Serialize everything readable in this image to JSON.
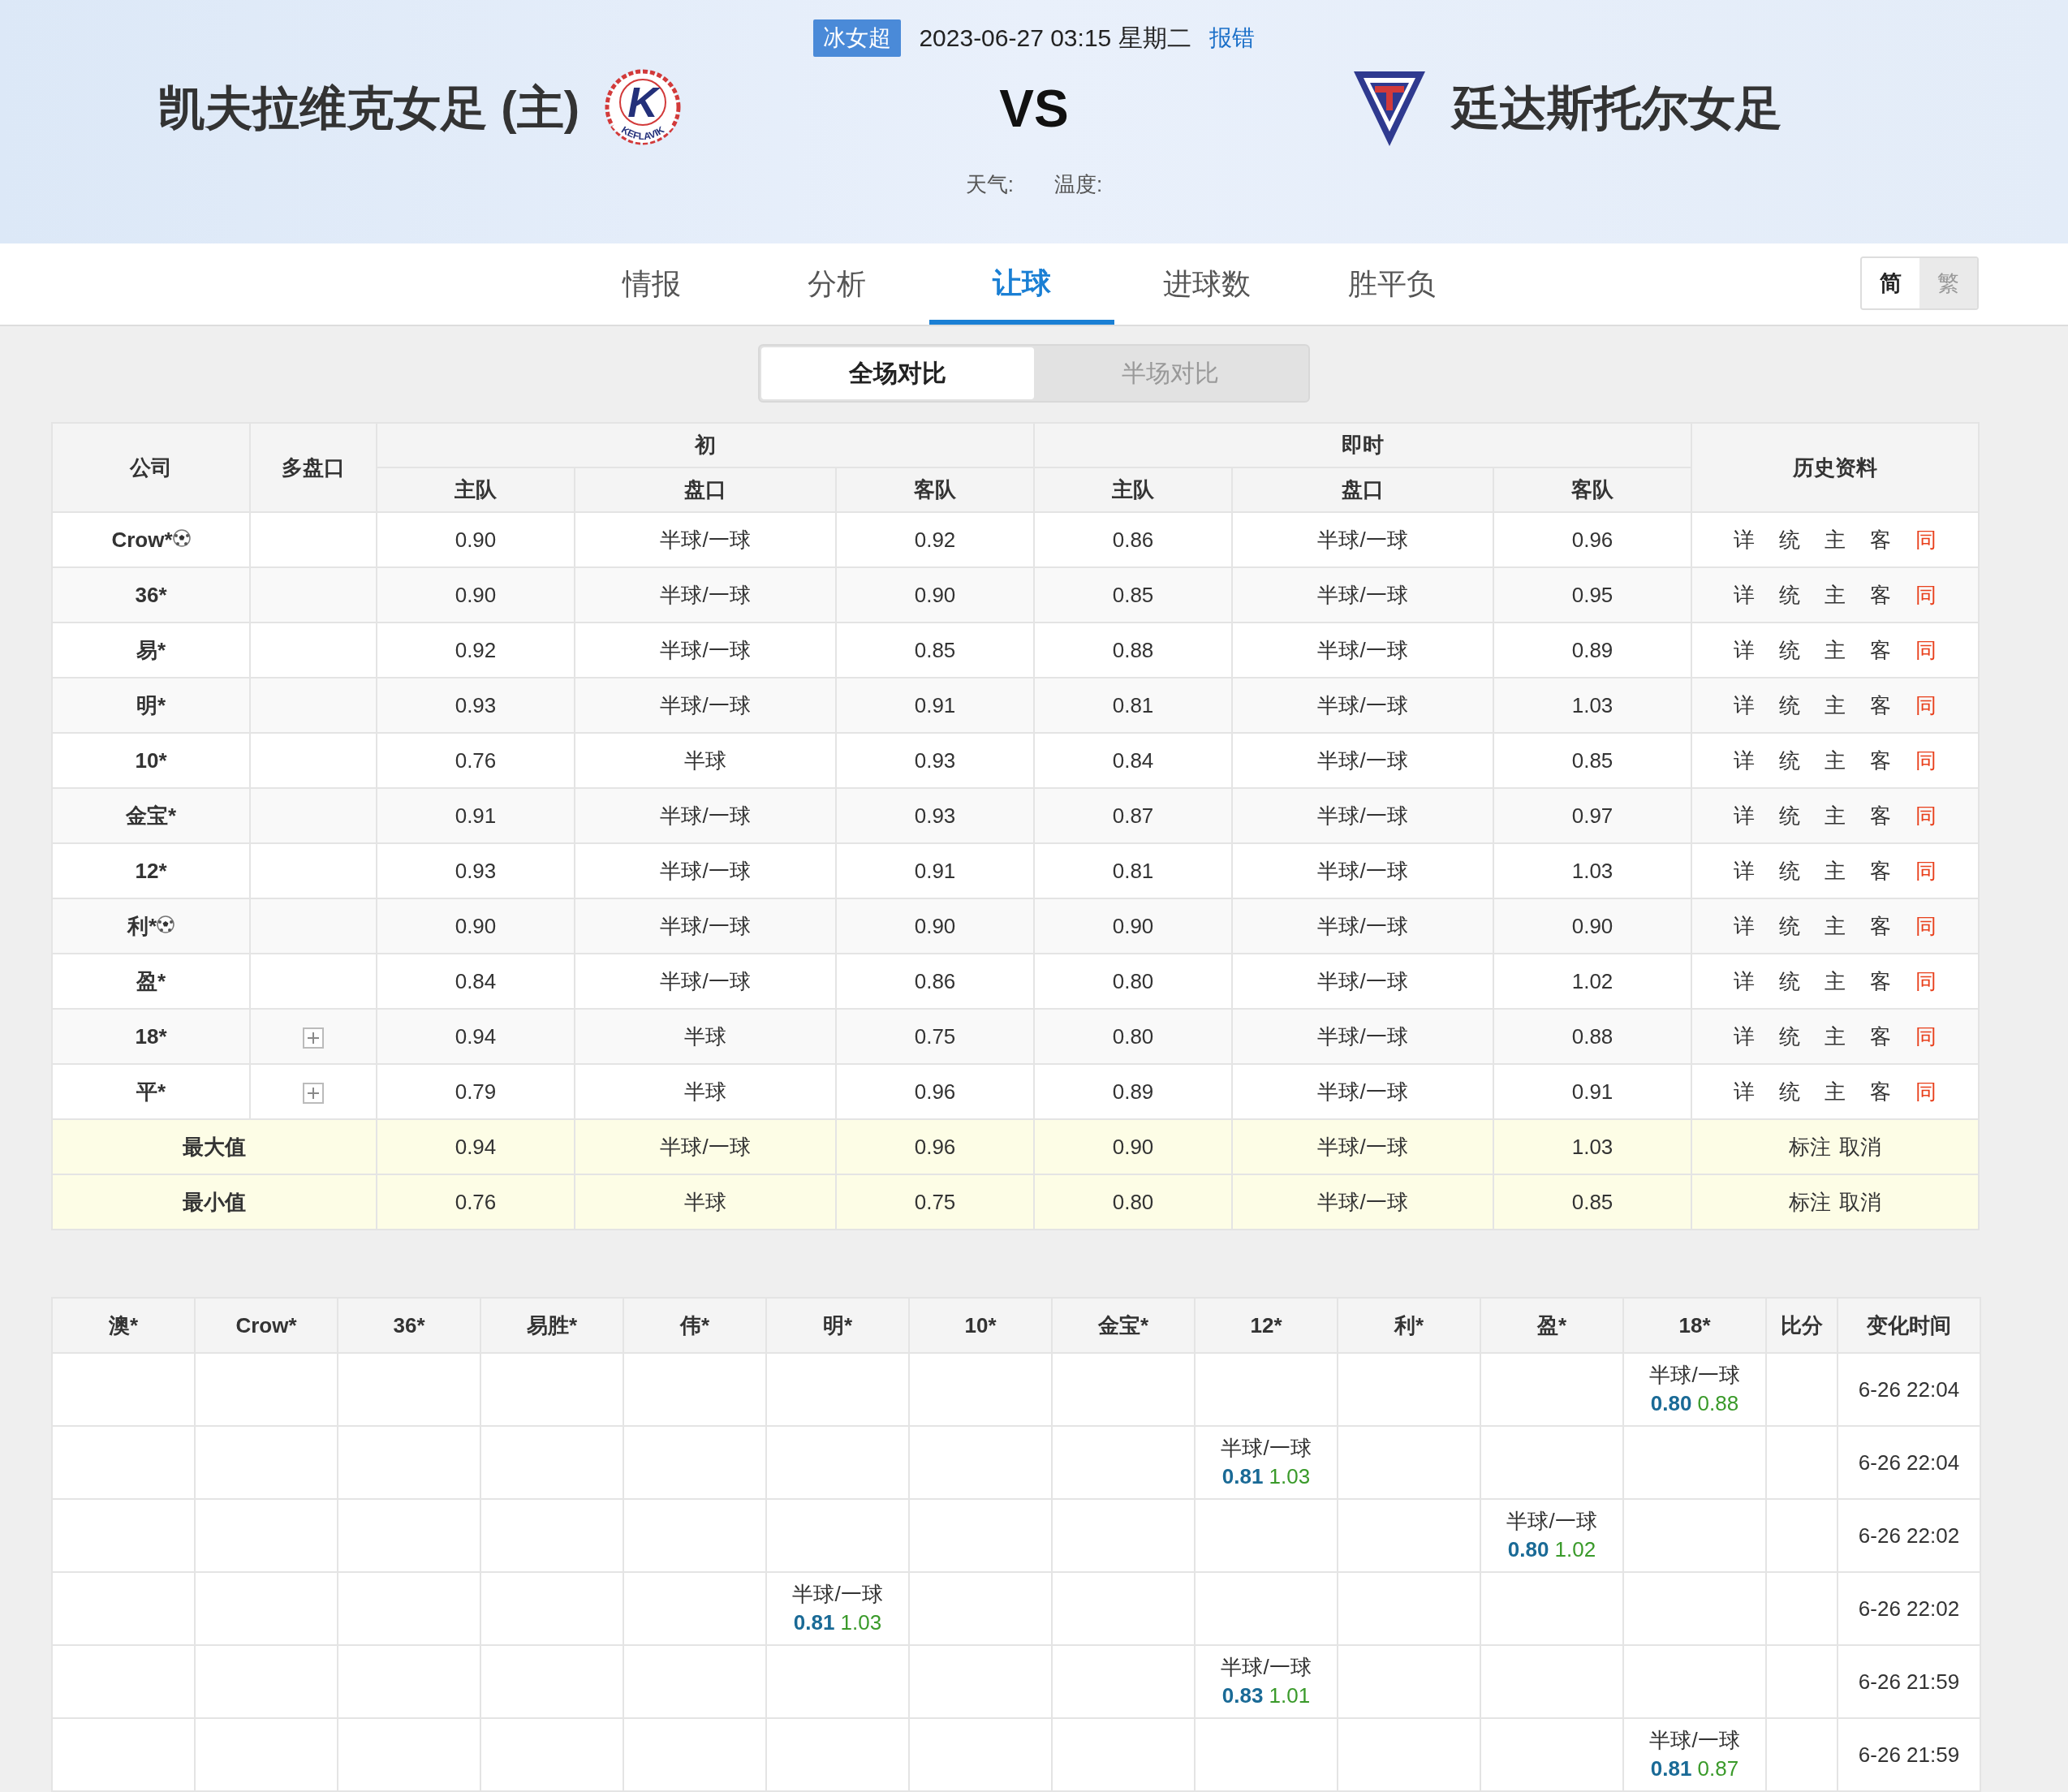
{
  "header": {
    "league": "冰女超",
    "datetime": "2023-06-27 03:15 星期二",
    "report_link": "报错",
    "home": {
      "name": "凯夫拉维克女足 (主)",
      "logo_letter": "K",
      "logo_text": "KEFLAVIK"
    },
    "vs": "VS",
    "away": {
      "name": "廷达斯托尔女足"
    },
    "weather_label": "天气:",
    "temperature_label": "温度:"
  },
  "tabs": [
    {
      "label": "情报",
      "selected": false
    },
    {
      "label": "分析",
      "selected": false
    },
    {
      "label": "让球",
      "selected": true
    },
    {
      "label": "进球数",
      "selected": false
    },
    {
      "label": "胜平负",
      "selected": false
    }
  ],
  "script_toggle": [
    {
      "label": "简",
      "selected": true
    },
    {
      "label": "繁",
      "selected": false
    }
  ],
  "compare_tabs": [
    {
      "label": "全场对比",
      "selected": true
    },
    {
      "label": "半场对比",
      "selected": false
    }
  ],
  "odds_table": {
    "head": {
      "company": "公司",
      "multi": "多盘口",
      "initial": "初",
      "live": "即时",
      "history": "历史资料",
      "sub": [
        "主队",
        "盘口",
        "客队",
        "主队",
        "盘口",
        "客队"
      ]
    },
    "rows": [
      {
        "company": "Crow*",
        "ball": true,
        "multi": false,
        "initial": [
          "0.90",
          "半球/一球",
          "0.92"
        ],
        "live": [
          "0.86",
          "半球/一球",
          "0.96"
        ],
        "links": [
          {
            "label": "详",
            "color": "#333333"
          },
          {
            "label": "统",
            "color": "#333333"
          },
          {
            "label": "主",
            "color": "#333333"
          },
          {
            "label": "客",
            "color": "#333333"
          },
          {
            "label": "同",
            "color": "#e8401c"
          }
        ]
      },
      {
        "company": "36*",
        "ball": false,
        "multi": false,
        "initial": [
          "0.90",
          "半球/一球",
          "0.90"
        ],
        "live": [
          "0.85",
          "半球/一球",
          "0.95"
        ],
        "links": [
          {
            "label": "详",
            "color": "#333333"
          },
          {
            "label": "统",
            "color": "#333333"
          },
          {
            "label": "主",
            "color": "#333333"
          },
          {
            "label": "客",
            "color": "#333333"
          },
          {
            "label": "同",
            "color": "#e8401c"
          }
        ]
      },
      {
        "company": "易*",
        "ball": false,
        "multi": false,
        "initial": [
          "0.92",
          "半球/一球",
          "0.85"
        ],
        "live": [
          "0.88",
          "半球/一球",
          "0.89"
        ],
        "links": [
          {
            "label": "详",
            "color": "#333333"
          },
          {
            "label": "统",
            "color": "#333333"
          },
          {
            "label": "主",
            "color": "#333333"
          },
          {
            "label": "客",
            "color": "#333333"
          },
          {
            "label": "同",
            "color": "#e8401c"
          }
        ]
      },
      {
        "company": "明*",
        "ball": false,
        "multi": false,
        "initial": [
          "0.93",
          "半球/一球",
          "0.91"
        ],
        "live": [
          "0.81",
          "半球/一球",
          "1.03"
        ],
        "links": [
          {
            "label": "详",
            "color": "#333333"
          },
          {
            "label": "统",
            "color": "#333333"
          },
          {
            "label": "主",
            "color": "#333333"
          },
          {
            "label": "客",
            "color": "#333333"
          },
          {
            "label": "同",
            "color": "#e8401c"
          }
        ]
      },
      {
        "company": "10*",
        "ball": false,
        "multi": false,
        "initial": [
          "0.76",
          "半球",
          "0.93"
        ],
        "live": [
          "0.84",
          "半球/一球",
          "0.85"
        ],
        "links": [
          {
            "label": "详",
            "color": "#333333"
          },
          {
            "label": "统",
            "color": "#333333"
          },
          {
            "label": "主",
            "color": "#333333"
          },
          {
            "label": "客",
            "color": "#333333"
          },
          {
            "label": "同",
            "color": "#e8401c"
          }
        ]
      },
      {
        "company": "金宝*",
        "ball": false,
        "multi": false,
        "initial": [
          "0.91",
          "半球/一球",
          "0.93"
        ],
        "live": [
          "0.87",
          "半球/一球",
          "0.97"
        ],
        "links": [
          {
            "label": "详",
            "color": "#333333"
          },
          {
            "label": "统",
            "color": "#333333"
          },
          {
            "label": "主",
            "color": "#333333"
          },
          {
            "label": "客",
            "color": "#333333"
          },
          {
            "label": "同",
            "color": "#e8401c"
          }
        ]
      },
      {
        "company": "12*",
        "ball": false,
        "multi": false,
        "initial": [
          "0.93",
          "半球/一球",
          "0.91"
        ],
        "live": [
          "0.81",
          "半球/一球",
          "1.03"
        ],
        "links": [
          {
            "label": "详",
            "color": "#333333"
          },
          {
            "label": "统",
            "color": "#333333"
          },
          {
            "label": "主",
            "color": "#333333"
          },
          {
            "label": "客",
            "color": "#333333"
          },
          {
            "label": "同",
            "color": "#e8401c"
          }
        ]
      },
      {
        "company": "利*",
        "ball": true,
        "multi": false,
        "initial": [
          "0.90",
          "半球/一球",
          "0.90"
        ],
        "live": [
          "0.90",
          "半球/一球",
          "0.90"
        ],
        "links": [
          {
            "label": "详",
            "color": "#333333"
          },
          {
            "label": "统",
            "color": "#333333"
          },
          {
            "label": "主",
            "color": "#333333"
          },
          {
            "label": "客",
            "color": "#333333"
          },
          {
            "label": "同",
            "color": "#e8401c"
          }
        ]
      },
      {
        "company": "盈*",
        "ball": false,
        "multi": false,
        "initial": [
          "0.84",
          "半球/一球",
          "0.86"
        ],
        "live": [
          "0.80",
          "半球/一球",
          "1.02"
        ],
        "links": [
          {
            "label": "详",
            "color": "#333333"
          },
          {
            "label": "统",
            "color": "#333333"
          },
          {
            "label": "主",
            "color": "#333333"
          },
          {
            "label": "客",
            "color": "#333333"
          },
          {
            "label": "同",
            "color": "#e8401c"
          }
        ]
      },
      {
        "company": "18*",
        "ball": false,
        "multi": true,
        "initial": [
          "0.94",
          "半球",
          "0.75"
        ],
        "live": [
          "0.80",
          "半球/一球",
          "0.88"
        ],
        "links": [
          {
            "label": "详",
            "color": "#333333"
          },
          {
            "label": "统",
            "color": "#333333"
          },
          {
            "label": "主",
            "color": "#333333"
          },
          {
            "label": "客",
            "color": "#333333"
          },
          {
            "label": "同",
            "color": "#e8401c"
          }
        ]
      },
      {
        "company": "平*",
        "ball": false,
        "multi": true,
        "initial": [
          "0.79",
          "半球",
          "0.96"
        ],
        "live": [
          "0.89",
          "半球/一球",
          "0.91"
        ],
        "links": [
          {
            "label": "详",
            "color": "#333333"
          },
          {
            "label": "统",
            "color": "#333333"
          },
          {
            "label": "主",
            "color": "#333333"
          },
          {
            "label": "客",
            "color": "#333333"
          },
          {
            "label": "同",
            "color": "#e8401c"
          }
        ]
      }
    ],
    "summary": [
      {
        "label": "最大值",
        "initial": [
          "0.94",
          "半球/一球",
          "0.96"
        ],
        "live": [
          "0.90",
          "半球/一球",
          "1.03"
        ],
        "actions": [
          "标注",
          "取消"
        ]
      },
      {
        "label": "最小值",
        "initial": [
          "0.76",
          "半球",
          "0.75"
        ],
        "live": [
          "0.80",
          "半球/一球",
          "0.85"
        ],
        "actions": [
          "标注",
          "取消"
        ]
      }
    ]
  },
  "changes_table": {
    "columns": [
      "澳*",
      "Crow*",
      "36*",
      "易胜*",
      "伟*",
      "明*",
      "10*",
      "金宝*",
      "12*",
      "利*",
      "盈*",
      "18*",
      "比分",
      "变化时间"
    ],
    "rows": [
      {
        "cells": [
          {
            "kind": "empty"
          },
          {
            "kind": "empty"
          },
          {
            "kind": "empty"
          },
          {
            "kind": "empty"
          },
          {
            "kind": "empty"
          },
          {
            "kind": "empty"
          },
          {
            "kind": "empty"
          },
          {
            "kind": "empty"
          },
          {
            "kind": "empty"
          },
          {
            "kind": "empty"
          },
          {
            "kind": "empty"
          },
          {
            "kind": "odds",
            "line": "半球/一球",
            "home": "0.80",
            "away": "0.88"
          }
        ],
        "time": "6-26 22:04"
      },
      {
        "cells": [
          {
            "kind": "empty"
          },
          {
            "kind": "empty"
          },
          {
            "kind": "empty"
          },
          {
            "kind": "empty"
          },
          {
            "kind": "empty"
          },
          {
            "kind": "empty"
          },
          {
            "kind": "empty"
          },
          {
            "kind": "empty"
          },
          {
            "kind": "odds",
            "line": "半球/一球",
            "home": "0.81",
            "away": "1.03"
          },
          {
            "kind": "empty"
          },
          {
            "kind": "empty"
          },
          {
            "kind": "empty"
          }
        ],
        "time": "6-26 22:04"
      },
      {
        "cells": [
          {
            "kind": "empty"
          },
          {
            "kind": "empty"
          },
          {
            "kind": "empty"
          },
          {
            "kind": "empty"
          },
          {
            "kind": "empty"
          },
          {
            "kind": "empty"
          },
          {
            "kind": "empty"
          },
          {
            "kind": "empty"
          },
          {
            "kind": "empty"
          },
          {
            "kind": "empty"
          },
          {
            "kind": "odds",
            "line": "半球/一球",
            "home": "0.80",
            "away": "1.02"
          },
          {
            "kind": "empty"
          }
        ],
        "time": "6-26 22:02"
      },
      {
        "cells": [
          {
            "kind": "empty"
          },
          {
            "kind": "empty"
          },
          {
            "kind": "empty"
          },
          {
            "kind": "empty"
          },
          {
            "kind": "empty"
          },
          {
            "kind": "odds",
            "line": "半球/一球",
            "home": "0.81",
            "away": "1.03"
          },
          {
            "kind": "empty"
          },
          {
            "kind": "empty"
          },
          {
            "kind": "empty"
          },
          {
            "kind": "empty"
          },
          {
            "kind": "empty"
          },
          {
            "kind": "empty"
          }
        ],
        "time": "6-26 22:02"
      },
      {
        "cells": [
          {
            "kind": "empty"
          },
          {
            "kind": "empty"
          },
          {
            "kind": "empty"
          },
          {
            "kind": "empty"
          },
          {
            "kind": "empty"
          },
          {
            "kind": "empty"
          },
          {
            "kind": "empty"
          },
          {
            "kind": "empty"
          },
          {
            "kind": "odds",
            "line": "半球/一球",
            "home": "0.83",
            "away": "1.01"
          },
          {
            "kind": "empty"
          },
          {
            "kind": "empty"
          },
          {
            "kind": "empty"
          }
        ],
        "time": "6-26 21:59"
      },
      {
        "cells": [
          {
            "kind": "empty"
          },
          {
            "kind": "empty"
          },
          {
            "kind": "empty"
          },
          {
            "kind": "empty"
          },
          {
            "kind": "empty"
          },
          {
            "kind": "empty"
          },
          {
            "kind": "empty"
          },
          {
            "kind": "empty"
          },
          {
            "kind": "empty"
          },
          {
            "kind": "empty"
          },
          {
            "kind": "empty"
          },
          {
            "kind": "odds",
            "line": "半球/一球",
            "home": "0.81",
            "away": "0.87"
          }
        ],
        "time": "6-26 21:59"
      }
    ]
  }
}
